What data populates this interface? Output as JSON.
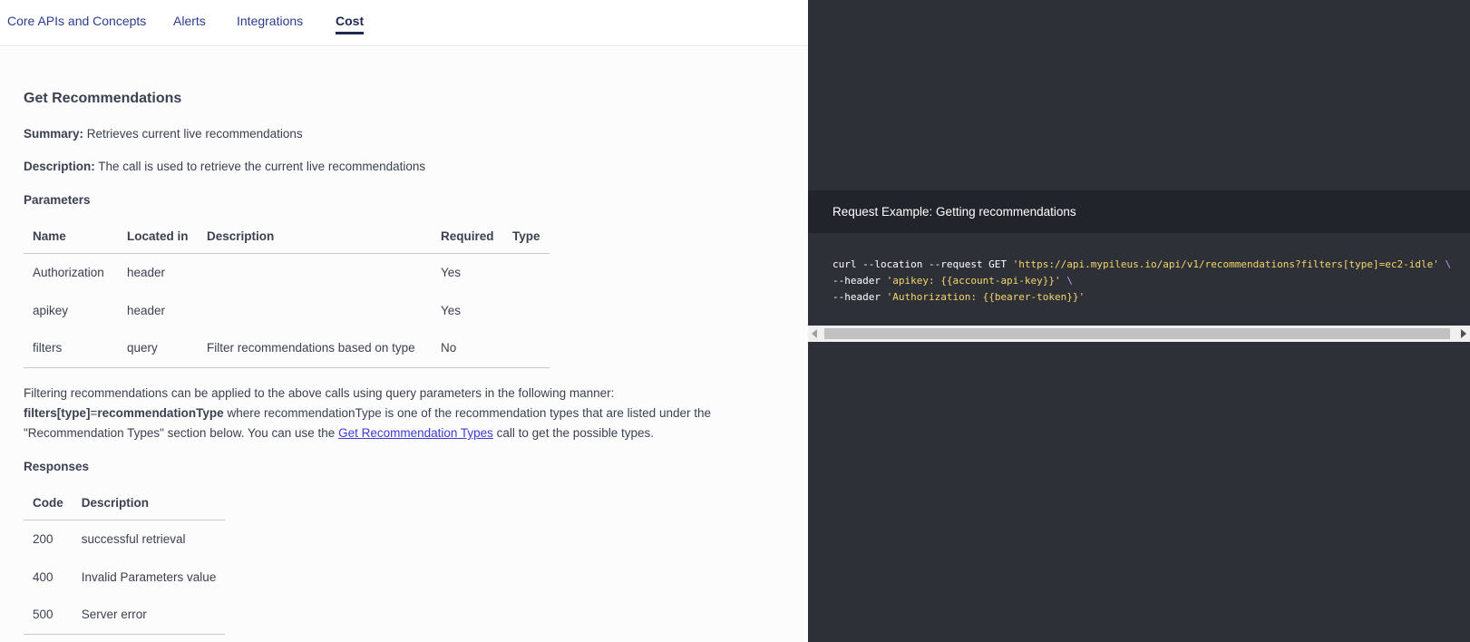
{
  "nav": {
    "tabs": [
      "Core APIs and Concepts",
      "Alerts",
      "Integrations",
      "Cost"
    ],
    "active_tab": "Cost"
  },
  "endpoint": {
    "title": "Get Recommendations",
    "summary_label": "Summary:",
    "summary_text": " Retrieves current live recommendations",
    "description_label": "Description:",
    "description_text": " The call is used to retrieve the current live recommendations"
  },
  "parameters": {
    "title": "Parameters",
    "columns": [
      "Name",
      "Located in",
      "Description",
      "Required",
      "Type"
    ],
    "rows": [
      [
        "Authorization",
        "header",
        "",
        "Yes",
        ""
      ],
      [
        "apikey",
        "header",
        "",
        "Yes",
        ""
      ],
      [
        "filters",
        "query",
        "Filter recommendations based on type",
        "No",
        ""
      ]
    ]
  },
  "filtering": {
    "line1": "Filtering recommendations can be applied to the above calls using query parameters in the following manner:",
    "bold_code": "filters[type]",
    "equals": "=",
    "bold_value": "recommendationType",
    "line2_rest": " where recommendationType is one of the recommendation types that are listed under the",
    "line3_start": "\"Recommendation Types\" section below. You can use the ",
    "link_text": "Get Recommendation Types",
    "line3_end": " call to get the possible types."
  },
  "responses": {
    "title": "Responses",
    "columns": [
      "Code",
      "Description"
    ],
    "rows": [
      [
        "200",
        "successful retrieval"
      ],
      [
        "400",
        "Invalid Parameters value"
      ],
      [
        "500",
        "Server error"
      ]
    ]
  },
  "request_example": {
    "title": "Request Example: Getting recommendations",
    "line1_cmd": "curl --location --request GET ",
    "line1_url": "'https://api.mypileus.io/api/v1/recommendations?filters[type]=ec2-idle'",
    "line1_cont": " \\",
    "line2_flag": "--header ",
    "line2_val": "'apikey: {{account-api-key}}'",
    "line2_cont": " \\",
    "line3_flag": "--header ",
    "line3_val": "'Authorization: {{bearer-token}}'"
  },
  "colors": {
    "nav_link": "#2a3d8f",
    "dark_panel": "#2e3038",
    "header_strip": "#22242b",
    "code_string": "#f4d66a",
    "link": "#3b3bd8"
  }
}
